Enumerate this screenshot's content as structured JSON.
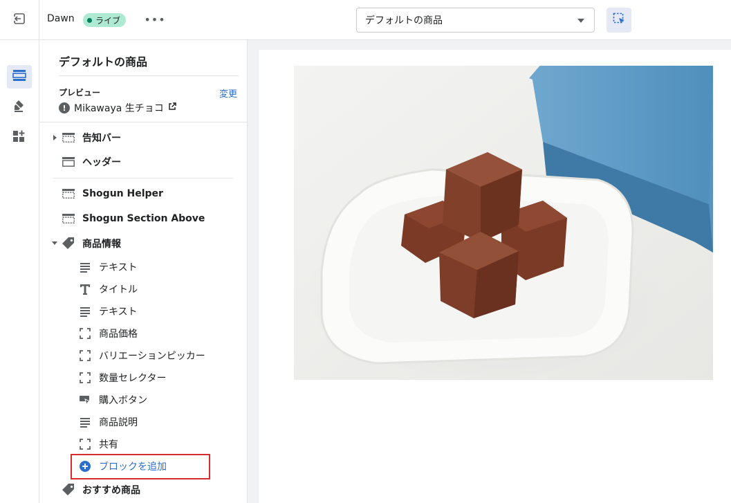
{
  "topbar": {
    "theme_name": "Dawn",
    "live_badge": "ライブ",
    "more_label": "•••",
    "template_select": {
      "value": "デフォルトの商品"
    }
  },
  "rail": {
    "items": [
      {
        "icon": "sections-icon",
        "active": true
      },
      {
        "icon": "theme-settings-icon",
        "active": false
      },
      {
        "icon": "apps-icon",
        "active": false
      }
    ]
  },
  "sidebar": {
    "title": "デフォルトの商品",
    "preview_label": "プレビュー",
    "change_link": "変更",
    "preview_product": "Mikawaya 生チョコ",
    "header_sections": [
      {
        "label": "告知バー",
        "icon": "section-dashed-icon",
        "collapsed": true
      },
      {
        "label": "ヘッダー",
        "icon": "section-icon"
      }
    ],
    "template_sections": [
      {
        "label": "Shogun Helper",
        "icon": "section-dashed-icon"
      },
      {
        "label": "Shogun Section Above",
        "icon": "section-dashed-icon"
      },
      {
        "label": "商品情報",
        "icon": "tag-icon",
        "expanded": true
      }
    ],
    "blocks": [
      {
        "label": "テキスト",
        "icon": "text-lines-icon"
      },
      {
        "label": "タイトル",
        "icon": "title-t-icon"
      },
      {
        "label": "テキスト",
        "icon": "text-lines-icon"
      },
      {
        "label": "商品価格",
        "icon": "dashed-box-icon"
      },
      {
        "label": "バリエーションピッカー",
        "icon": "dashed-box-icon"
      },
      {
        "label": "数量セレクター",
        "icon": "dashed-box-icon"
      },
      {
        "label": "購入ボタン",
        "icon": "buy-button-icon"
      },
      {
        "label": "商品説明",
        "icon": "text-lines-icon"
      },
      {
        "label": "共有",
        "icon": "dashed-box-icon"
      }
    ],
    "add_block": "ブロックを追加",
    "next_section": {
      "label": "おすすめ商品",
      "icon": "tag-icon"
    }
  },
  "colors": {
    "accent": "#2c6ecb",
    "live_badge_bg": "#aee9d1",
    "highlight": "#d72c2c",
    "active_bg": "#e4e9f5"
  },
  "preview": {
    "image_subject": "chocolate-truffles-on-white-plate"
  }
}
